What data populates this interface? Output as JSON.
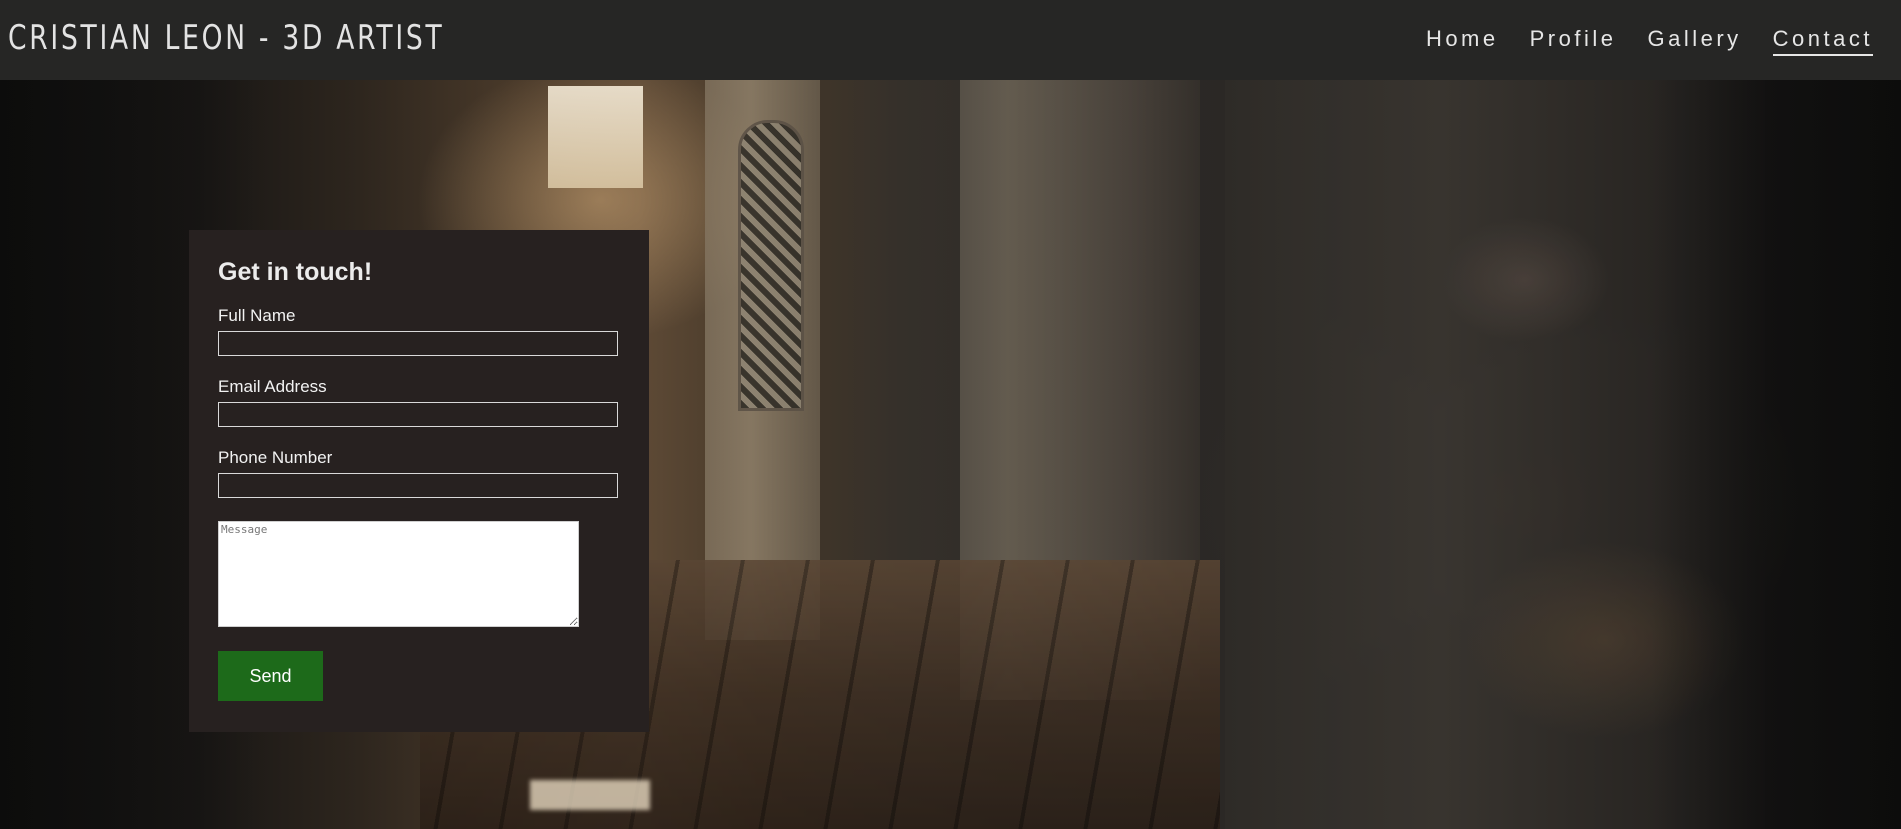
{
  "header": {
    "brand": "CRISTIAN LEON - 3D ARTIST",
    "nav": [
      {
        "label": "Home",
        "active": false
      },
      {
        "label": "Profile",
        "active": false
      },
      {
        "label": "Gallery",
        "active": false
      },
      {
        "label": "Contact",
        "active": true
      }
    ]
  },
  "contact_form": {
    "title": "Get in touch!",
    "full_name": {
      "label": "Full Name",
      "value": ""
    },
    "email": {
      "label": "Email Address",
      "value": ""
    },
    "phone": {
      "label": "Phone Number",
      "value": ""
    },
    "message": {
      "placeholder": "Message",
      "value": ""
    },
    "send_label": "Send"
  },
  "colors": {
    "header_bg": "#262625",
    "card_bg": "#272120",
    "send_button": "#1d6a1a",
    "text": "#f2f2f2"
  }
}
